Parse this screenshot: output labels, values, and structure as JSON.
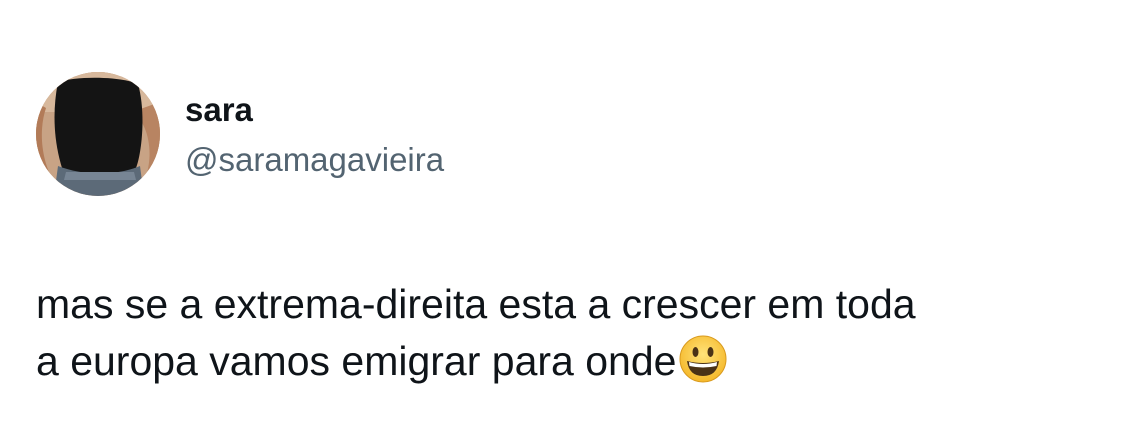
{
  "user": {
    "display_name": "sara",
    "handle": "@saramagavieira",
    "avatar_icon": "profile-photo"
  },
  "tweet": {
    "lines": [
      "mas se a extrema-direita esta a crescer em toda",
      "a europa vamos emigrar para onde"
    ],
    "emoji": "grinning-face-emoji"
  },
  "colors": {
    "text_primary": "#0f1419",
    "text_secondary": "#536471",
    "background": "#ffffff"
  }
}
